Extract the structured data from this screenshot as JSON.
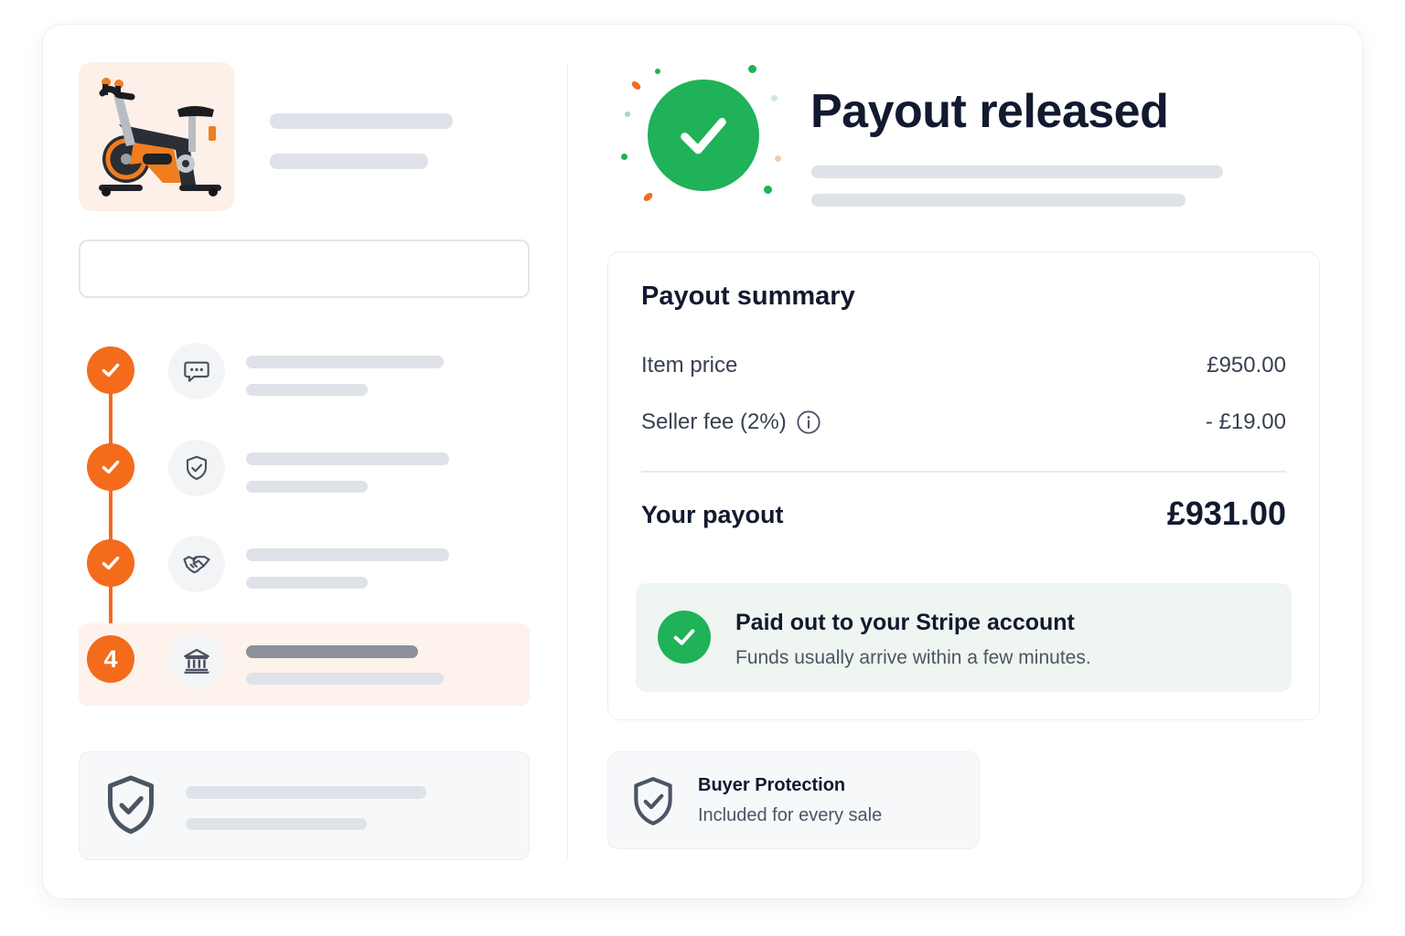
{
  "hero": {
    "title": "Payout released"
  },
  "steps": [
    {
      "status": "done",
      "icon": "chat-bubble-icon"
    },
    {
      "status": "done",
      "icon": "shield-check-icon"
    },
    {
      "status": "done",
      "icon": "handshake-icon"
    },
    {
      "status": "current",
      "number": "4",
      "icon": "bank-icon"
    }
  ],
  "summary": {
    "title": "Payout summary",
    "item_price_label": "Item price",
    "item_price_value": "£950.00",
    "seller_fee_label": "Seller fee (2%)",
    "seller_fee_value": "- £19.00",
    "payout_label": "Your payout",
    "payout_value": "£931.00"
  },
  "stripe_notice": {
    "title": "Paid out to your Stripe account",
    "subtitle": "Funds usually arrive within a few minutes."
  },
  "buyer_protection": {
    "title": "Buyer Protection",
    "subtitle": "Included for every sale"
  },
  "colors": {
    "accent_orange": "#f46b1c",
    "success_green": "#1fb258",
    "text_dark": "#111a2e",
    "skeleton": "#dfe2e8"
  }
}
